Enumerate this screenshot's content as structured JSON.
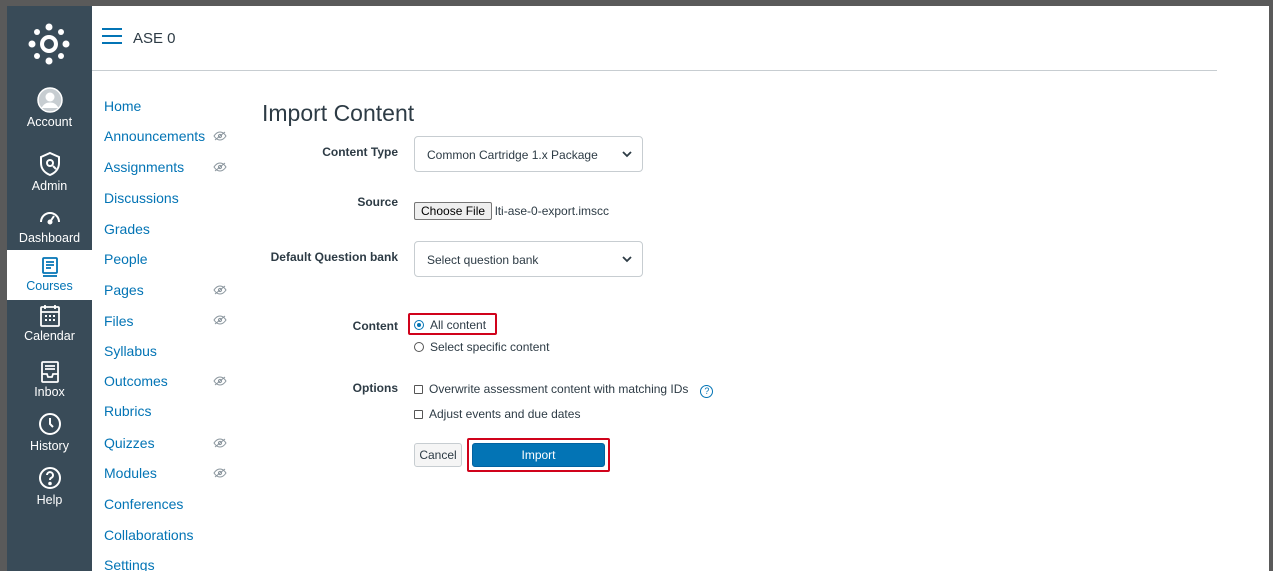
{
  "global_nav": {
    "items": [
      {
        "label": "Account",
        "icon": "account-icon"
      },
      {
        "label": "Admin",
        "icon": "admin-icon"
      },
      {
        "label": "Dashboard",
        "icon": "dashboard-icon"
      },
      {
        "label": "Courses",
        "icon": "courses-icon",
        "active": true
      },
      {
        "label": "Calendar",
        "icon": "calendar-icon"
      },
      {
        "label": "Inbox",
        "icon": "inbox-icon"
      },
      {
        "label": "History",
        "icon": "history-icon"
      },
      {
        "label": "Help",
        "icon": "help-icon"
      }
    ]
  },
  "header": {
    "breadcrumb": "ASE 0"
  },
  "course_nav": {
    "items": [
      {
        "label": "Home",
        "hidden": false
      },
      {
        "label": "Announcements",
        "hidden": true
      },
      {
        "label": "Assignments",
        "hidden": true
      },
      {
        "label": "Discussions",
        "hidden": false
      },
      {
        "label": "Grades",
        "hidden": false
      },
      {
        "label": "People",
        "hidden": false
      },
      {
        "label": "Pages",
        "hidden": true
      },
      {
        "label": "Files",
        "hidden": true
      },
      {
        "label": "Syllabus",
        "hidden": false
      },
      {
        "label": "Outcomes",
        "hidden": true
      },
      {
        "label": "Rubrics",
        "hidden": false
      },
      {
        "label": "Quizzes",
        "hidden": true
      },
      {
        "label": "Modules",
        "hidden": true
      },
      {
        "label": "Conferences",
        "hidden": false
      },
      {
        "label": "Collaborations",
        "hidden": false
      },
      {
        "label": "Settings",
        "hidden": false
      }
    ]
  },
  "form": {
    "title": "Import Content",
    "content_type_label": "Content Type",
    "content_type_value": "Common Cartridge 1.x Package",
    "source_label": "Source",
    "choose_file_label": "Choose File",
    "file_name": "lti-ase-0-export.imscc",
    "question_bank_label": "Default Question bank",
    "question_bank_value": "Select question bank",
    "content_label": "Content",
    "content_options": [
      {
        "label": "All content",
        "checked": true
      },
      {
        "label": "Select specific content",
        "checked": false
      }
    ],
    "options_label": "Options",
    "options": [
      {
        "label": "Overwrite assessment content with matching IDs",
        "checked": false,
        "help": "?"
      },
      {
        "label": "Adjust events and due dates",
        "checked": false
      }
    ],
    "cancel_label": "Cancel",
    "import_label": "Import"
  },
  "colors": {
    "global_nav_bg": "#394b58",
    "link": "#0374b5",
    "primary_button": "#0374b5",
    "highlight": "#d0021b"
  }
}
